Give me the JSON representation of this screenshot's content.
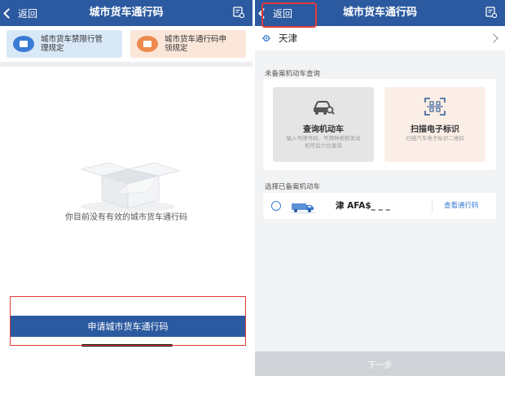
{
  "left": {
    "navbar": {
      "back_label": "返回",
      "title": "城市货车通行码",
      "right_icon": "receipt-icon"
    },
    "quick_cards": [
      {
        "label": "城市货车禁限行管理规定",
        "icon": "document-icon",
        "color": "#3a7bd5"
      },
      {
        "label": "城市货车通行码申领规定",
        "icon": "document-icon",
        "color": "#ee8a4f"
      }
    ],
    "empty_text": "你目前没有有效的城市货车通行码",
    "apply_button": "申请城市货车通行码"
  },
  "right": {
    "navbar": {
      "back_label": "返回",
      "title": "城市货车通行码",
      "right_icon": "receipt-icon"
    },
    "city": "天津",
    "unregistered_section": "未备案机动车查询",
    "options": [
      {
        "title": "查询机动车",
        "desc": "输入号牌号码、号牌种类和发动机号后六位查询",
        "icon": "car-search-icon"
      },
      {
        "title": "扫描电子标识",
        "desc": "扫描汽车电子标识二维码",
        "icon": "scan-icon"
      }
    ],
    "registered_section": "选择已备案机动车",
    "vehicle": {
      "plate": "津 AFA$_ _ _",
      "action": "查看通行码"
    },
    "next_button": "下一步"
  },
  "colors": {
    "primary": "#2c5aa0",
    "highlight": "#e23b3b",
    "link": "#3a7bd5"
  }
}
